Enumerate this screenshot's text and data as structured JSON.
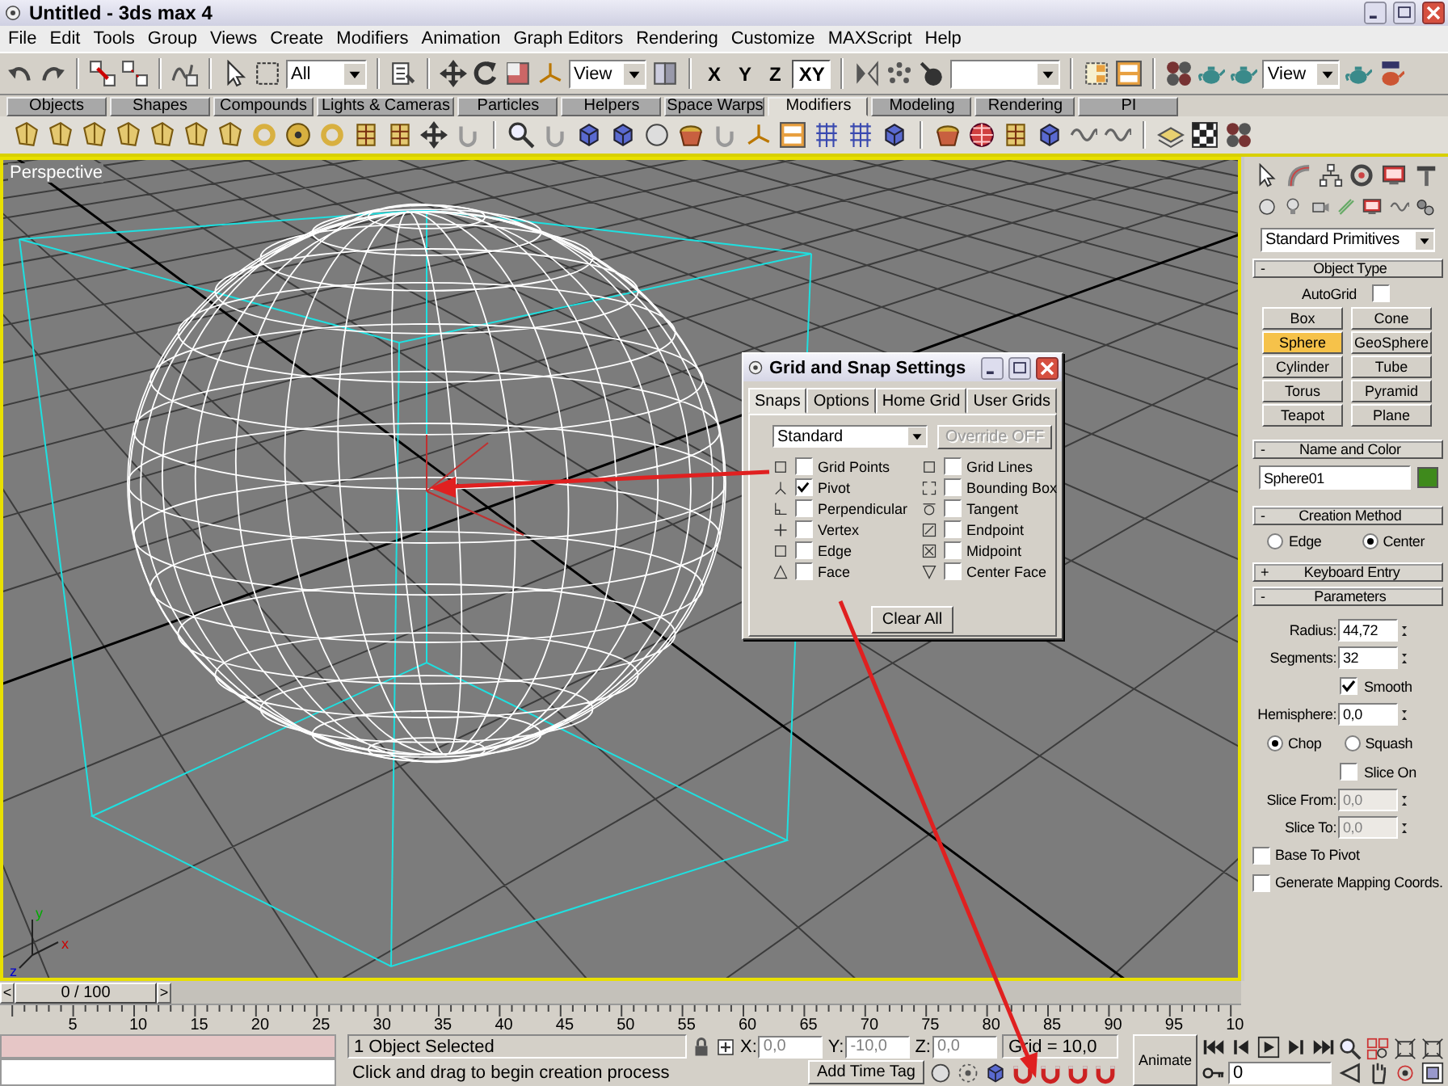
{
  "window": {
    "title": "Untitled - 3ds max 4"
  },
  "menu": [
    "File",
    "Edit",
    "Tools",
    "Group",
    "Views",
    "Create",
    "Modifiers",
    "Animation",
    "Graph Editors",
    "Rendering",
    "Customize",
    "MAXScript",
    "Help"
  ],
  "main_toolbar": {
    "selection_filter": "All",
    "reference_coordinate_system": "View",
    "render_type": "View",
    "axis_buttons": [
      {
        "label": "X",
        "selected": false
      },
      {
        "label": "Y",
        "selected": false
      },
      {
        "label": "Z",
        "selected": false
      },
      {
        "label": "XY",
        "selected": true
      }
    ]
  },
  "tab_panel": [
    {
      "label": "Objects",
      "selected": false
    },
    {
      "label": "Shapes",
      "selected": false
    },
    {
      "label": "Compounds",
      "selected": false
    },
    {
      "label": "Lights & Cameras",
      "selected": false
    },
    {
      "label": "Particles",
      "selected": false
    },
    {
      "label": "Helpers",
      "selected": false
    },
    {
      "label": "Space Warps",
      "selected": false
    },
    {
      "label": "Modifiers",
      "selected": true
    },
    {
      "label": "Modeling",
      "selected": false
    },
    {
      "label": "Rendering",
      "selected": false
    },
    {
      "label": "PI",
      "selected": false
    }
  ],
  "viewport": {
    "label": "Perspective",
    "active": true,
    "axis_labels": [
      "x",
      "y",
      "z"
    ]
  },
  "snap_dialog": {
    "title": "Grid and Snap Settings",
    "tabs": [
      {
        "label": "Snaps",
        "selected": true
      },
      {
        "label": "Options",
        "selected": false
      },
      {
        "label": "Home Grid",
        "selected": false
      },
      {
        "label": "User Grids",
        "selected": false
      }
    ],
    "snap_set": "Standard",
    "override_button": {
      "label": "Override OFF",
      "disabled": true
    },
    "snaps": [
      {
        "label": "Grid Points",
        "checked": false
      },
      {
        "label": "Grid Lines",
        "checked": false
      },
      {
        "label": "Pivot",
        "checked": true
      },
      {
        "label": "Bounding Box",
        "checked": false
      },
      {
        "label": "Perpendicular",
        "checked": false
      },
      {
        "label": "Tangent",
        "checked": false
      },
      {
        "label": "Vertex",
        "checked": false
      },
      {
        "label": "Endpoint",
        "checked": false
      },
      {
        "label": "Edge",
        "checked": false
      },
      {
        "label": "Midpoint",
        "checked": false
      },
      {
        "label": "Face",
        "checked": false
      },
      {
        "label": "Center Face",
        "checked": false
      }
    ],
    "clear_button": "Clear All"
  },
  "command_panel": {
    "category": "Standard Primitives",
    "object_type": {
      "sign": "-",
      "title": "Object Type",
      "autogrid": {
        "label": "AutoGrid",
        "checked": false
      },
      "buttons": [
        {
          "label": "Box",
          "selected": false
        },
        {
          "label": "Cone",
          "selected": false
        },
        {
          "label": "Sphere",
          "selected": true
        },
        {
          "label": "GeoSphere",
          "selected": false
        },
        {
          "label": "Cylinder",
          "selected": false
        },
        {
          "label": "Tube",
          "selected": false
        },
        {
          "label": "Torus",
          "selected": false
        },
        {
          "label": "Pyramid",
          "selected": false
        },
        {
          "label": "Teapot",
          "selected": false
        },
        {
          "label": "Plane",
          "selected": false
        }
      ]
    },
    "name_and_color": {
      "sign": "-",
      "title": "Name and Color",
      "name": "Sphere01",
      "color": "#3f8a1c"
    },
    "creation_method": {
      "sign": "-",
      "title": "Creation Method",
      "options": [
        {
          "label": "Edge",
          "selected": false
        },
        {
          "label": "Center",
          "selected": true
        }
      ]
    },
    "keyboard_entry": {
      "sign": "+",
      "title": "Keyboard Entry"
    },
    "parameters": {
      "sign": "-",
      "title": "Parameters",
      "rows": [
        {
          "kind": "spinner",
          "label": "Radius:",
          "value": "44,72",
          "disabled": false
        },
        {
          "kind": "spinner",
          "label": "Segments:",
          "value": "32",
          "disabled": false
        },
        {
          "kind": "toggle",
          "label": "Smooth",
          "checked": true
        },
        {
          "kind": "spinner",
          "label": "Hemisphere:",
          "value": "0,0",
          "disabled": false
        },
        {
          "kind": "radios",
          "options": [
            {
              "label": "Chop",
              "selected": true
            },
            {
              "label": "Squash",
              "selected": false
            }
          ]
        },
        {
          "kind": "toggle",
          "label": "Slice On",
          "checked": false
        },
        {
          "kind": "spinner",
          "label": "Slice From:",
          "value": "0,0",
          "disabled": true
        },
        {
          "kind": "spinner",
          "label": "Slice To:",
          "value": "0,0",
          "disabled": true
        },
        {
          "kind": "checkbox",
          "label": "Base To Pivot",
          "checked": false
        },
        {
          "kind": "checkbox",
          "label": "Generate Mapping Coords.",
          "checked": false
        }
      ]
    }
  },
  "timeline": {
    "prev": "<",
    "frame_label": "0 / 100",
    "next": ">",
    "ticks": [
      "5",
      "10",
      "15",
      "20",
      "25",
      "30",
      "35",
      "40",
      "45",
      "50",
      "55",
      "60",
      "65",
      "70",
      "75",
      "80",
      "85",
      "90",
      "95",
      "10"
    ]
  },
  "status": {
    "selection": "1 Object Selected",
    "prompt": "Click and drag to begin creation process",
    "coordinates": [
      {
        "label": "X:",
        "value": "0,0",
        "disabled": true
      },
      {
        "label": "Y:",
        "value": "-10,0",
        "disabled": true
      },
      {
        "label": "Z:",
        "value": "0,0",
        "disabled": true
      }
    ],
    "grid": "Grid = 10,0",
    "time_tag": "Add Time Tag",
    "animate": "Animate",
    "frame": "0"
  }
}
